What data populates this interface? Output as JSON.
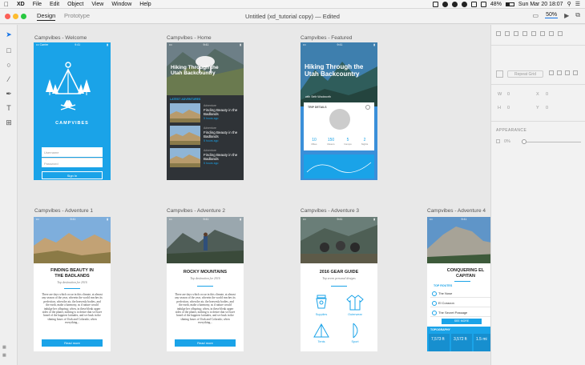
{
  "menubar": {
    "items": [
      "XD",
      "File",
      "Edit",
      "Object",
      "View",
      "Window",
      "Help"
    ],
    "battery": "48%",
    "datetime": "Sun Mar 20  18:07"
  },
  "titlebar": {
    "tab_design": "Design",
    "tab_prototype": "Prototype",
    "doc_title": "Untitled (xd_tutorial copy) — Edited",
    "zoom": "50%"
  },
  "artboards": {
    "welcome": {
      "label": "Campvibes - Welcome",
      "brand": "CAMPVIBES",
      "username_placeholder": "Username",
      "password_placeholder": "Password",
      "signin": "Sign In"
    },
    "home": {
      "label": "Campvibes - Home",
      "hero_title": "Hiking Through the Utah Backcountry",
      "list_header": "LATEST ADVENTURES",
      "rows": [
        {
          "cat": "Adventure",
          "title": "Finding Beauty in the Badlands",
          "link": "5 hours ago"
        },
        {
          "cat": "Adventure",
          "title": "Finding Beauty in the Badlands",
          "link": "5 hours ago"
        },
        {
          "cat": "Adventure",
          "title": "Finding Beauty in the Badlands",
          "link": "5 hours ago"
        }
      ]
    },
    "featured": {
      "label": "Campvibes - Featured",
      "hero_title": "Hiking Through the Utah Backcountry",
      "byline": "with Seth Woolworth",
      "card_title": "TRIP DETAILS",
      "stats": [
        {
          "value": "10",
          "label": "Miles"
        },
        {
          "value": "150",
          "label": "Meters"
        },
        {
          "value": "5",
          "label": "Camps"
        },
        {
          "value": "2",
          "label": "Nights"
        }
      ]
    },
    "adv1": {
      "label": "Campvibes - Adventure 1",
      "title": "FINDING BEAUTY IN THE BADLANDS",
      "subtitle": "Top destination for 2016",
      "body": "There are days which occur in this climate, at almost any season of the year, wherein the world reaches its perfection, when the air, the heavenly bodies, and the earth, make a harmony, as if nature would indulge her offspring; when, in these bleak upper sides of the planet, nothing is to desire that we have heard of the happiest latitudes, and we bask in the shining hours of Utah and Colorado; when everything...",
      "button": "Read more"
    },
    "adv2": {
      "label": "Campvibes - Adventure 2",
      "title": "ROCKY MOUNTAINS",
      "subtitle": "Top destination for 2016",
      "body": "There are days which occur in this climate, at almost any season of the year, wherein the world reaches its perfection, when the air, the heavenly bodies, and the earth, make a harmony, as if nature would indulge her offspring; when, in these bleak upper sides of the planet, nothing is to desire that we have heard of the happiest latitudes, and we bask in the shining hours of Utah and Colorado; when everything...",
      "button": "Read more"
    },
    "adv3": {
      "label": "Campvibes - Adventure 3",
      "title": "2016 GEAR GUIDE",
      "subtitle": "Top seven personal designs",
      "items": [
        "Supplies",
        "Outerwear",
        "Tents",
        "Sport"
      ]
    },
    "adv4": {
      "label": "Campvibes - Adventure 4",
      "title": "CONQUERING EL CAPITAN",
      "routes_header": "TOP ROUTES",
      "routes": [
        "The Nose",
        "El Corazon",
        "The Secret Passage"
      ],
      "see_more": "SEE MORE",
      "topo": "TOPOGRAPHY",
      "tiles": [
        "7,573 ft",
        "3,572 ft",
        "1.5 mi"
      ]
    }
  },
  "rpanel": {
    "repeat_grid": "Repeat Grid",
    "w": "W",
    "x": "X",
    "h": "H",
    "y": "Y",
    "w_val": "0",
    "x_val": "0",
    "h_val": "0",
    "y_val": "0",
    "appearance": "APPEARANCE",
    "opacity": "0%"
  },
  "toolbar_bottom": "ctrl"
}
